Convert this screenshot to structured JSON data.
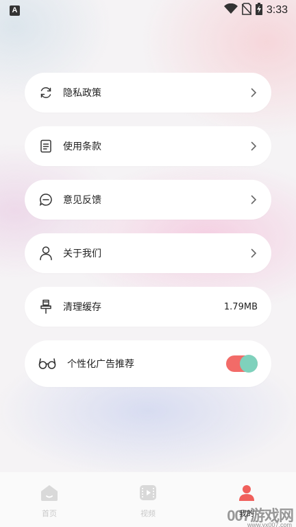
{
  "status_bar": {
    "notification_icon": "A",
    "time": "3:33"
  },
  "menu": {
    "privacy_policy": "隐私政策",
    "terms_of_use": "使用条款",
    "feedback": "意见反馈",
    "about_us": "关于我们",
    "clear_cache": "清理缓存",
    "cache_size": "1.79MB",
    "personalized_ads": "个性化广告推荐",
    "personalized_ads_enabled": true
  },
  "bottom_nav": {
    "home": "首页",
    "video": "视频",
    "mine": "我的"
  },
  "colors": {
    "toggle_track": "#f26b68",
    "toggle_knob": "#7fd1bc",
    "active_nav": "#f0605c",
    "inactive_nav": "#d6d6d6"
  },
  "watermark": {
    "brand": "007游戏网",
    "url": "www.yx007.com"
  }
}
